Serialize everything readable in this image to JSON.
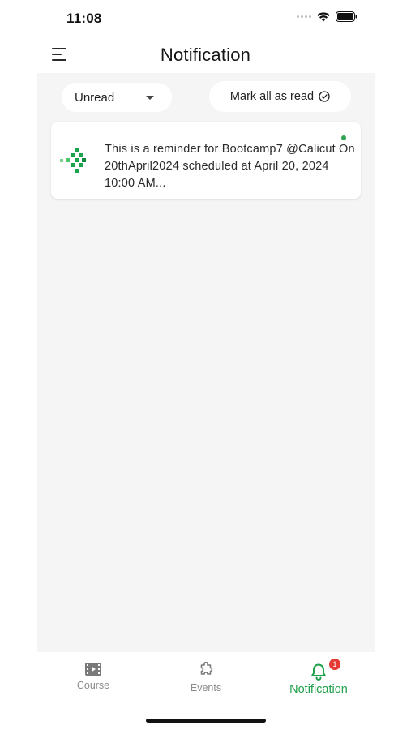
{
  "status_bar": {
    "time": "11:08"
  },
  "header": {
    "title": "Notification"
  },
  "filter": {
    "selected": "Unread"
  },
  "actions": {
    "mark_all_read_label": "Mark all as read"
  },
  "notifications": [
    {
      "text": "This is a reminder for Bootcamp7 @Calicut On 20thApril2024 scheduled at April 20, 2024 10:00 AM...",
      "unread": true
    }
  ],
  "bottom_nav": {
    "items": [
      {
        "label": "Course",
        "icon": "video-icon",
        "active": false
      },
      {
        "label": "Events",
        "icon": "puzzle-icon",
        "active": false
      },
      {
        "label": "Notification",
        "icon": "bell-icon",
        "active": true,
        "badge": "1"
      }
    ]
  },
  "colors": {
    "accent": "#1ea14a",
    "badge": "#e53935",
    "panel": "#f5f5f5"
  }
}
